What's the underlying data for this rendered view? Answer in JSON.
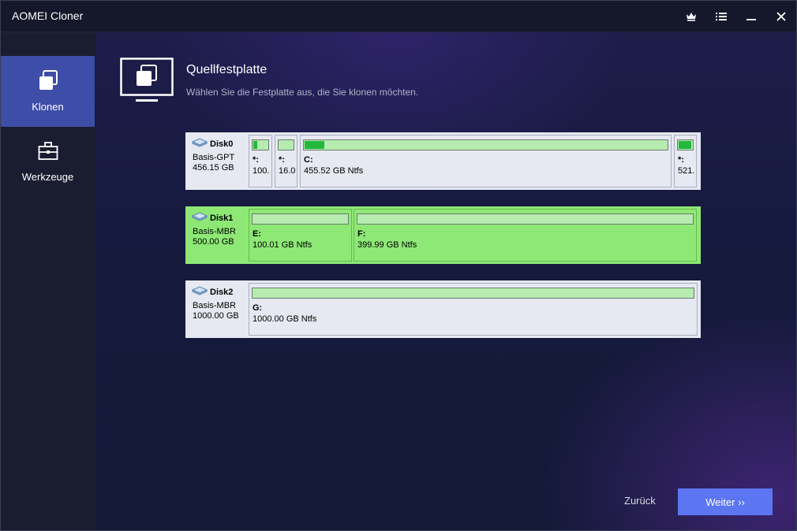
{
  "window": {
    "title": "AOMEI Cloner",
    "controls": [
      "crown-icon",
      "menu-list-icon",
      "minimize-icon",
      "close-icon"
    ]
  },
  "sidebar": {
    "items": [
      {
        "label": "Klonen",
        "icon": "clone-icon",
        "active": true
      },
      {
        "label": "Werkzeuge",
        "icon": "toolbox-icon",
        "active": false
      }
    ]
  },
  "main": {
    "title": "Quellfestplatte",
    "subtitle": "Wählen Sie die Festplatte aus, die Sie klonen möchten."
  },
  "disks": [
    {
      "name": "Disk0",
      "type": "Basis-GPT",
      "size": "456.15 GB",
      "selected": false,
      "partitions": [
        {
          "label": "*:",
          "desc": "100.",
          "used": 0.25
        },
        {
          "label": "*:",
          "desc": "16.0",
          "used": 0.0
        },
        {
          "label": "C:",
          "desc": "455.52 GB Ntfs",
          "used": 0.055
        },
        {
          "label": "*:",
          "desc": "521.",
          "used": 0.85
        }
      ]
    },
    {
      "name": "Disk1",
      "type": "Basis-MBR",
      "size": "500.00 GB",
      "selected": true,
      "partitions": [
        {
          "label": "E:",
          "desc": "100.01 GB Ntfs",
          "used": 0.0
        },
        {
          "label": "F:",
          "desc": "399.99 GB Ntfs",
          "used": 0.0
        }
      ]
    },
    {
      "name": "Disk2",
      "type": "Basis-MBR",
      "size": "1000.00 GB",
      "selected": false,
      "partitions": [
        {
          "label": "G:",
          "desc": "1000.00 GB Ntfs",
          "used": 0.0
        }
      ]
    }
  ],
  "footer": {
    "back_label": "Zurück",
    "next_label": "Weiter ››"
  },
  "colors": {
    "accent": "#5b76f0",
    "sidebar_active": "#3e4da8",
    "selected_disk": "#8ee876",
    "used_fill": "#22b83c",
    "free_bar": "#b6ecb0"
  }
}
